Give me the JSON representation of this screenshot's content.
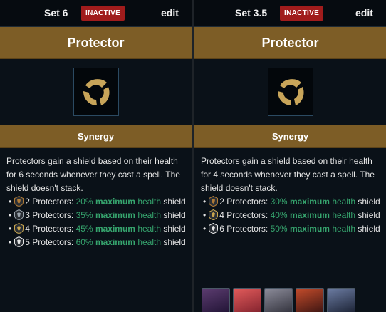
{
  "left": {
    "set_label": "Set 6",
    "badge": "INACTIVE",
    "edit": "edit",
    "trait_name": "Protector",
    "synergy_label": "Synergy",
    "description": "Protectors gain a shield based on their health for 6 seconds whenever they cast a spell. The shield doesn't stack.",
    "tiers": [
      {
        "label": "2 Protectors:",
        "pct": "20%",
        "max": "maximum",
        "rest": "health",
        "tail": "shield",
        "icon_color": "#b07a36"
      },
      {
        "label": "3 Protectors:",
        "pct": "35%",
        "max": "maximum",
        "rest": "health",
        "tail": "shield",
        "icon_color": "#9aa4ad"
      },
      {
        "label": "4 Protectors:",
        "pct": "45%",
        "max": "maximum",
        "rest": "health",
        "tail": "shield",
        "icon_color": "#c9a64e"
      },
      {
        "label": "5 Protectors:",
        "pct": "60%",
        "max": "maximum",
        "rest": "health",
        "tail": "shield",
        "icon_color": "#e6e6e6"
      }
    ]
  },
  "right": {
    "set_label": "Set 3.5",
    "badge": "INACTIVE",
    "edit": "edit",
    "trait_name": "Protector",
    "synergy_label": "Synergy",
    "description": "Protectors gain a shield based on their health for 4 seconds whenever they cast a spell. The shield doesn't stack.",
    "tiers": [
      {
        "label": "2 Protectors:",
        "pct": "30%",
        "max": "maximum",
        "rest": "health",
        "tail": "shield",
        "icon_color": "#b07a36"
      },
      {
        "label": "4 Protectors:",
        "pct": "40%",
        "max": "maximum",
        "rest": "health",
        "tail": "shield",
        "icon_color": "#c9a64e"
      },
      {
        "label": "6 Protectors:",
        "pct": "50%",
        "max": "maximum",
        "rest": "health",
        "tail": "shield",
        "icon_color": "#e6e6e6"
      }
    ],
    "champions": [
      "champion-1",
      "champion-2",
      "champion-3",
      "champion-4",
      "champion-5"
    ]
  },
  "colors": {
    "accent_bar": "#7d5d26",
    "badge_bg": "#a01c1c",
    "green": "#36a56e",
    "gold_icon": "#c8a55a"
  }
}
